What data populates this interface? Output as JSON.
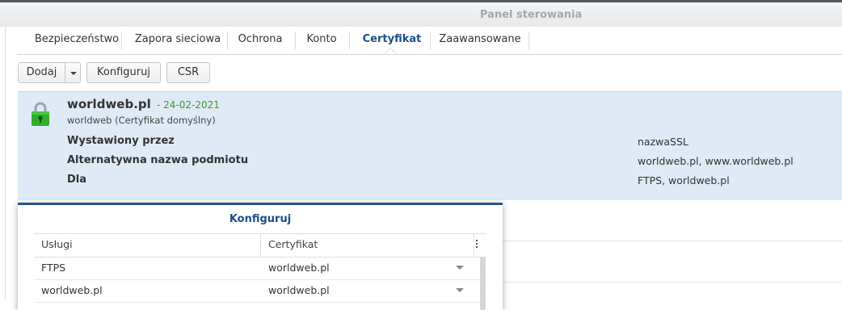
{
  "window": {
    "title": "Panel sterowania"
  },
  "tabs": [
    {
      "label": "Bezpieczeństwo"
    },
    {
      "label": "Zapora sieciowa"
    },
    {
      "label": "Ochrona"
    },
    {
      "label": "Konto"
    },
    {
      "label": "Certyfikat",
      "active": true
    },
    {
      "label": "Zaawansowane"
    }
  ],
  "toolbar": {
    "add_label": "Dodaj",
    "configure_label": "Konfiguruj",
    "csr_label": "CSR"
  },
  "certificate": {
    "name": "worldweb.pl",
    "date": "- 24-02-2021",
    "subtitle": "worldweb (Certyfikat domyślny)",
    "details": [
      {
        "label": "Wystawiony przez",
        "value": "nazwaSSL"
      },
      {
        "label": "Alternatywna nazwa podmiotu",
        "value": "worldweb.pl, www.worldweb.pl"
      },
      {
        "label": "Dla",
        "value": "FTPS, worldweb.pl"
      }
    ]
  },
  "dialog": {
    "title": "Konfiguruj",
    "columns": {
      "service": "Usługi",
      "certificate": "Certyfikat"
    },
    "rows": [
      {
        "service": "FTPS",
        "certificate": "worldweb.pl"
      },
      {
        "service": "worldweb.pl",
        "certificate": "worldweb.pl"
      }
    ]
  },
  "colors": {
    "accent": "#1b4f88",
    "selection": "#dfeaf6",
    "lock": "#2fae2a",
    "date": "#3d9a2c"
  }
}
